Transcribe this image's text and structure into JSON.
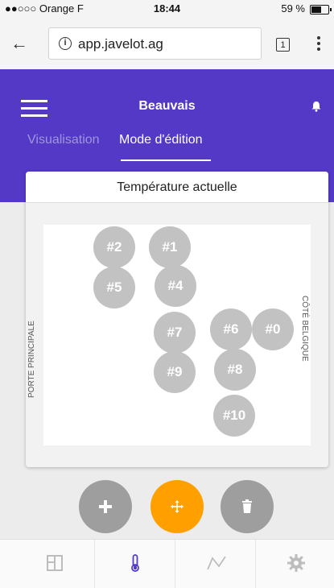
{
  "status_bar": {
    "carrier": "●●○○○ Orange F",
    "time": "18:44",
    "battery": "59 %",
    "battery_level": 0.59
  },
  "browser": {
    "url": "app.javelot.ag",
    "tab_count": "1"
  },
  "app_bar": {
    "title": "Beauvais",
    "tabs": [
      {
        "label": "Visualisation",
        "active": false
      },
      {
        "label": "Mode d'édition",
        "active": true
      }
    ],
    "color": "#5339c6"
  },
  "card": {
    "title": "Température actuelle",
    "left_label": "PORTE PRINCIPALE",
    "right_label": "CÔTÉ BELGIQUE"
  },
  "sensors": [
    {
      "label": "#2"
    },
    {
      "label": "#1"
    },
    {
      "label": "#5"
    },
    {
      "label": "#4"
    },
    {
      "label": "#7"
    },
    {
      "label": "#6"
    },
    {
      "label": "#0"
    },
    {
      "label": "#9"
    },
    {
      "label": "#8"
    },
    {
      "label": "#10"
    }
  ],
  "actions": {
    "add_icon": "plus-icon",
    "move_icon": "move-icon",
    "delete_icon": "trash-icon",
    "accent": "#ffa000"
  },
  "bottom_nav": [
    {
      "icon": "layout-icon",
      "active": false
    },
    {
      "icon": "thermometer-icon",
      "active": true
    },
    {
      "icon": "chart-line-icon",
      "active": false
    },
    {
      "icon": "gear-icon",
      "active": false
    }
  ]
}
